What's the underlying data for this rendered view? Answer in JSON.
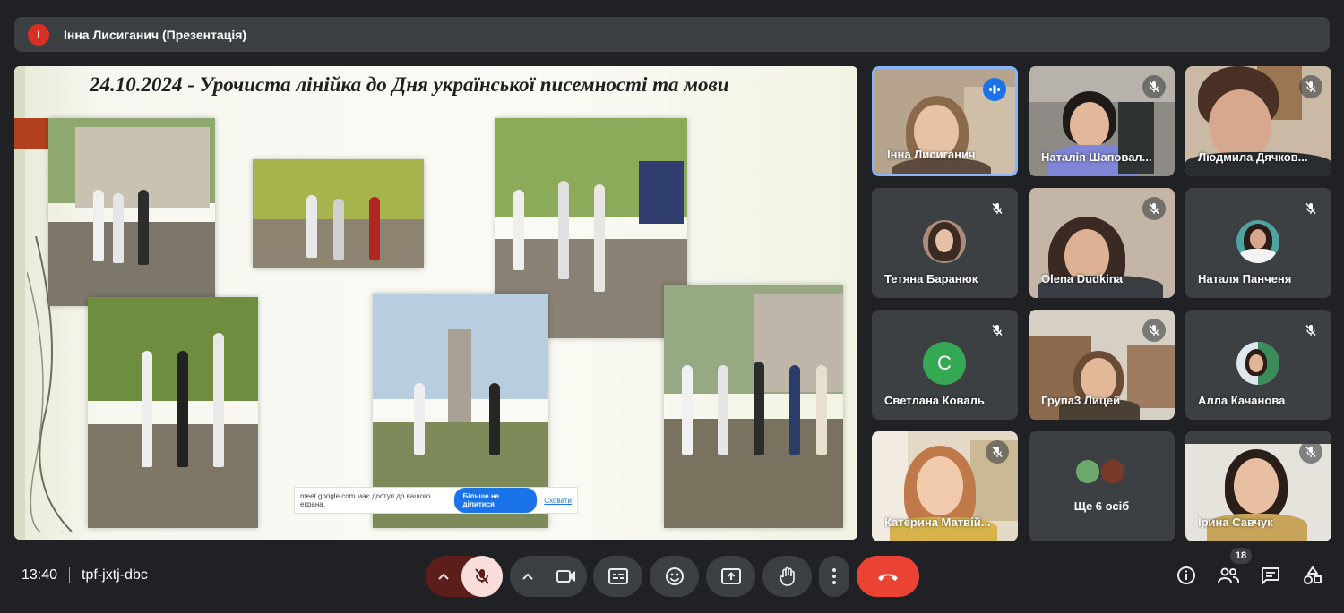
{
  "presenter": {
    "initial": "I",
    "title": "Інна Лисиганич (Презентація)"
  },
  "slide": {
    "title": "24.10.2024 - Урочиста лінійка до Дня української писемності та мови",
    "share_banner": {
      "text": "meet.google.com має доступ до вашого екрана.",
      "stop_label": "Більше не ділитися",
      "hide_label": "Сховати"
    }
  },
  "participants": [
    {
      "name": "Інна Лисиганич",
      "speaking": true
    },
    {
      "name": "Наталія Шаповал..."
    },
    {
      "name": "Людмила Дячков..."
    },
    {
      "name": "Тетяна Баранюк"
    },
    {
      "name": "Olena Dudkina"
    },
    {
      "name": "Наталя Панченя"
    },
    {
      "name": "Светлана Коваль",
      "initial": "C",
      "avatar_color": "#34a853"
    },
    {
      "name": "Група3 Лицей"
    },
    {
      "name": "Алла Качанова"
    },
    {
      "name": "Катерина Матвій..."
    },
    {
      "name": "Ще 6 осіб"
    },
    {
      "name": "Ірина Савчук"
    }
  ],
  "bottom": {
    "time": "13:40",
    "meeting_code": "tpf-jxtj-dbc",
    "participant_count": "18"
  },
  "colors": {
    "background": "#202124",
    "tile": "#3c4043",
    "accent": "#8ab4f8",
    "hangup": "#ea4335",
    "mic_off": "#f9dedc"
  },
  "icons": [
    "chevron-up-icon",
    "mic-off-icon",
    "camera-icon",
    "captions-icon",
    "emoji-icon",
    "present-icon",
    "raise-hand-icon",
    "more-vert-icon",
    "hang-up-icon",
    "info-icon",
    "people-icon",
    "chat-icon",
    "activities-icon"
  ]
}
